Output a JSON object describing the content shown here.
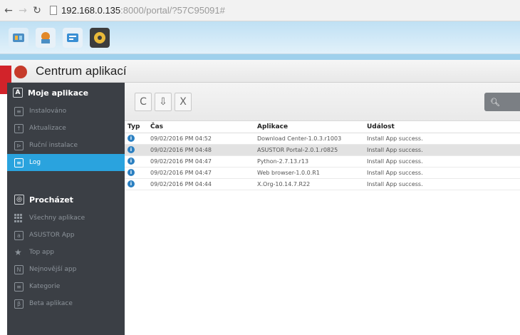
{
  "browser": {
    "address_host": "192.168.0.135",
    "address_rest": ":8000/portal/?57C95091#"
  },
  "topbar": {
    "icons": [
      "settings-icon",
      "app-central-icon",
      "access-control-icon",
      "storage-manager-icon"
    ]
  },
  "window": {
    "title": "Centrum aplikací"
  },
  "sidebar": {
    "section1": "Moje aplikace",
    "items1": [
      {
        "label": "Instalováno",
        "icon": "installed-icon"
      },
      {
        "label": "Aktualizace",
        "icon": "update-icon"
      },
      {
        "label": "Ruční instalace",
        "icon": "manual-install-icon"
      },
      {
        "label": "Log",
        "icon": "log-icon",
        "active": true
      }
    ],
    "section2": "Procházet",
    "items2": [
      {
        "label": "Všechny aplikace",
        "icon": "grid-icon"
      },
      {
        "label": "ASUSTOR App",
        "icon": "asustor-icon"
      },
      {
        "label": "Top app",
        "icon": "star-icon"
      },
      {
        "label": "Nejnovější app",
        "icon": "new-icon"
      },
      {
        "label": "Kategorie",
        "icon": "list-icon"
      },
      {
        "label": "Beta aplikace",
        "icon": "beta-icon"
      }
    ]
  },
  "toolbar": {
    "refresh": "C",
    "export": "⇩",
    "clear": "X"
  },
  "table": {
    "headers": {
      "typ": "Typ",
      "cas": "Čas",
      "aplikace": "Aplikace",
      "udalost": "Událost"
    },
    "rows": [
      {
        "cas": "09/02/2016 PM 04:52",
        "aplikace": "Download Center-1.0.3.r1003",
        "udalost": "Install App success."
      },
      {
        "cas": "09/02/2016 PM 04:48",
        "aplikace": "ASUSTOR Portal-2.0.1.r0825",
        "udalost": "Install App success."
      },
      {
        "cas": "09/02/2016 PM 04:47",
        "aplikace": "Python-2.7.13.r13",
        "udalost": "Install App success."
      },
      {
        "cas": "09/02/2016 PM 04:47",
        "aplikace": "Web browser-1.0.0.R1",
        "udalost": "Install App success."
      },
      {
        "cas": "09/02/2016 PM 04:44",
        "aplikace": "X.Org-10.14.7.R22",
        "udalost": "Install App success."
      }
    ]
  }
}
